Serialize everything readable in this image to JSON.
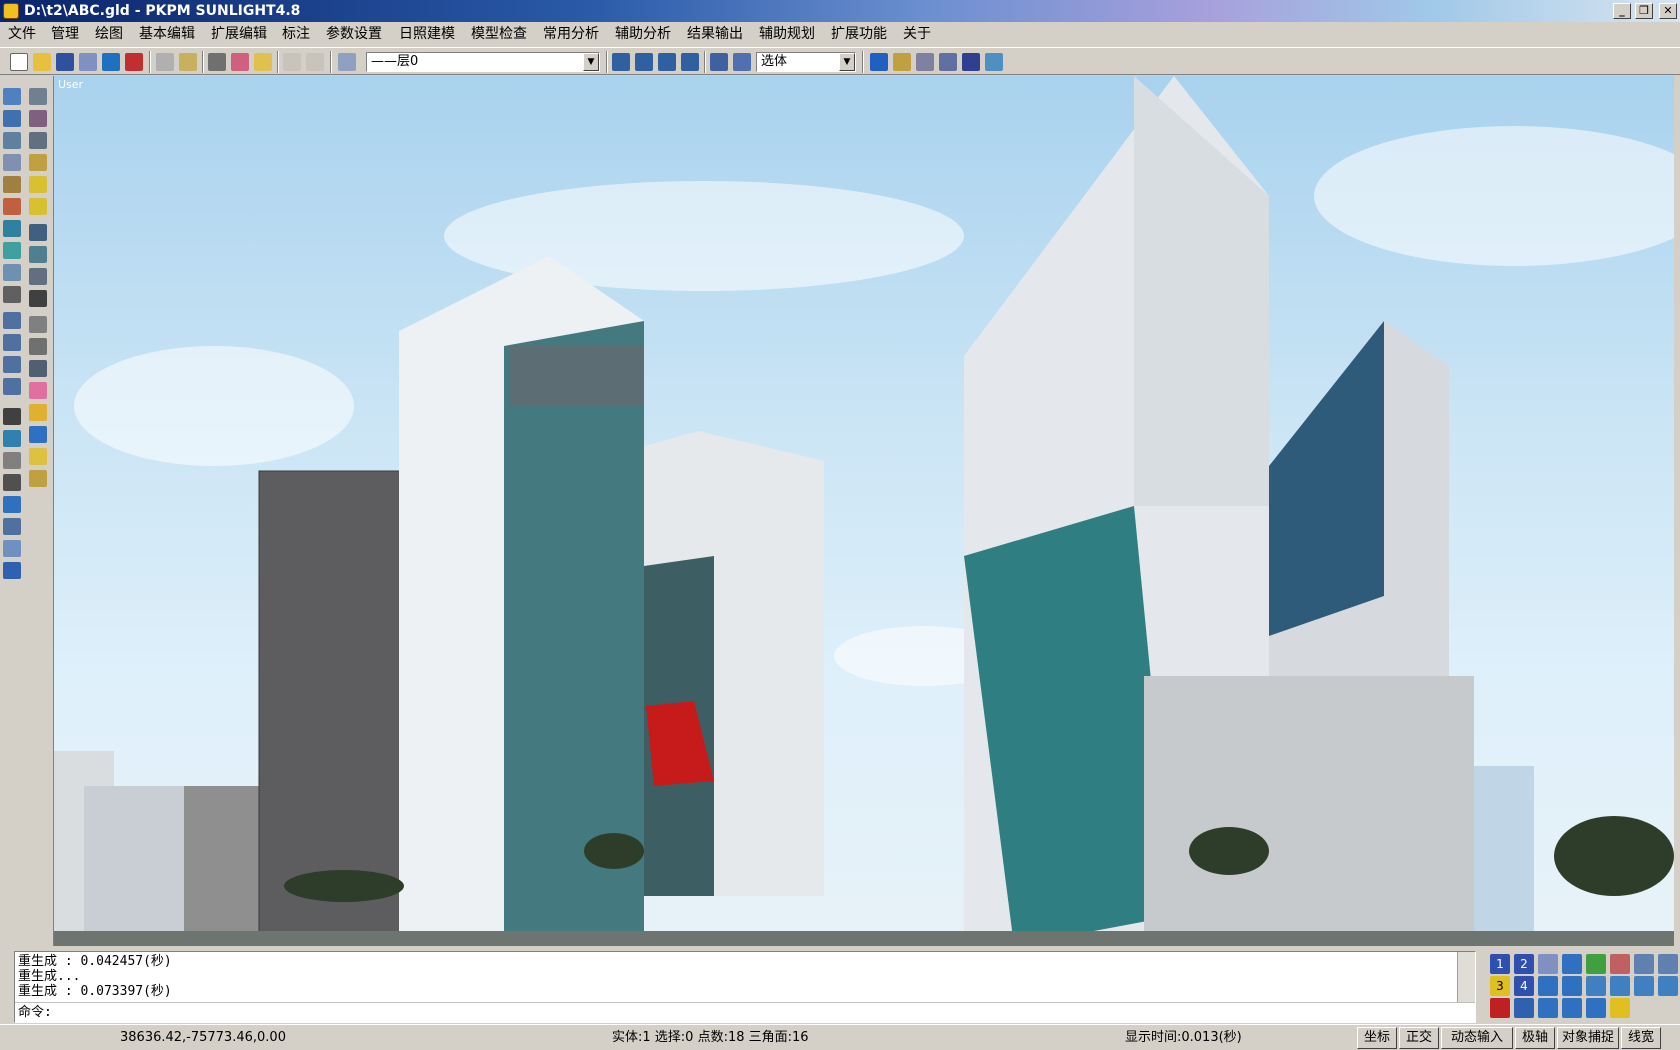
{
  "window": {
    "title": "D:\\t2\\ABC.gld - PKPM SUNLIGHT4.8",
    "minimize": "_",
    "restore": "❐",
    "close": "✕"
  },
  "menu": [
    "文件",
    "管理",
    "绘图",
    "基本编辑",
    "扩展编辑",
    "标注",
    "参数设置",
    "日照建模",
    "模型检查",
    "常用分析",
    "辅助分析",
    "结果输出",
    "辅助规划",
    "扩展功能",
    "关于"
  ],
  "toolbar": {
    "layer_combo": "——层0",
    "select_combo": "选体",
    "accent_color": "#1a3e8c"
  },
  "viewport": {
    "label": "User",
    "image": "rendered scene of modern high-rise towers with lattice facades and glass curtain walls under a blue sky"
  },
  "command": {
    "lines": [
      "重生成 : 0.042457(秒)",
      "重生成...",
      "重生成 : 0.073397(秒)"
    ],
    "prompt": "命令:"
  },
  "viewtools": {
    "view1": "1",
    "view2": "2",
    "view3": "3",
    "view4": "4"
  },
  "status": {
    "coords": "38636.42,-75773.46,0.00",
    "stats": "实体:1 选择:0 点数:18 三角面:16",
    "display_time": "显示时间:0.013(秒)",
    "toggles": [
      "坐标",
      "正交",
      "动态输入",
      "极轴",
      "对象捕捉",
      "线宽"
    ]
  }
}
